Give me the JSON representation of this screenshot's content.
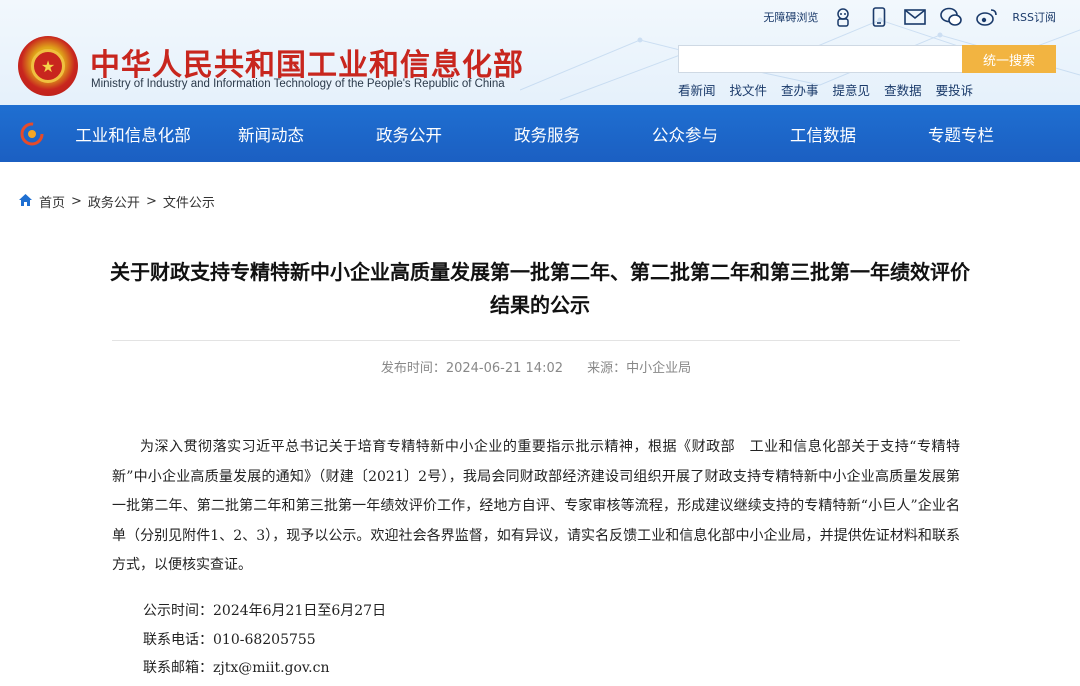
{
  "header": {
    "title": "中华人民共和国工业和信息化部",
    "subtitle": "Ministry of Industry and Information Technology of the People's Republic of China",
    "toplinks": {
      "accessibility": "无障碍浏览",
      "rss": "RSS订阅"
    },
    "search": {
      "placeholder": "",
      "button": "统一搜索"
    },
    "quick_links": [
      "看新闻",
      "找文件",
      "查办事",
      "提意见",
      "查数据",
      "要投诉"
    ]
  },
  "nav": {
    "items": [
      "工业和信息化部",
      "新闻动态",
      "政务公开",
      "政务服务",
      "公众参与",
      "工信数据",
      "专题专栏"
    ]
  },
  "breadcrumb": [
    "首页",
    "政务公开",
    "文件公示"
  ],
  "article": {
    "title": "关于财政支持专精特新中小企业高质量发展第一批第二年、第二批第二年和第三批第一年绩效评价结果的公示",
    "publish_time": "发布时间：2024-06-21 14:02",
    "source": "来源：中小企业局",
    "body": "为深入贯彻落实习近平总书记关于培育专精特新中小企业的重要指示批示精神，根据《财政部　工业和信息化部关于支持“专精特新”中小企业高质量发展的通知》（财建〔2021〕2号），我局会同财政部经济建设司组织开展了财政支持专精特新中小企业高质量发展第一批第二年、第二批第二年和第三批第一年绩效评价工作，经地方自评、专家审核等流程，形成建议继续支持的专精特新“小巨人”企业名单（分别见附件1、2、3），现予以公示。欢迎社会各界监督，如有异议，请实名反馈工业和信息化部中小企业局，并提供佐证材料和联系方式，以便核实查证。",
    "contact": {
      "period": "公示时间：2024年6月21日至6月27日",
      "phone": "联系电话：010-68205755",
      "email": "联系邮箱：zjtx@miit.gov.cn"
    }
  },
  "colors": {
    "brand_red": "#c8261e",
    "nav_blue": "#1f6fd1",
    "search_orange": "#f2b441"
  }
}
